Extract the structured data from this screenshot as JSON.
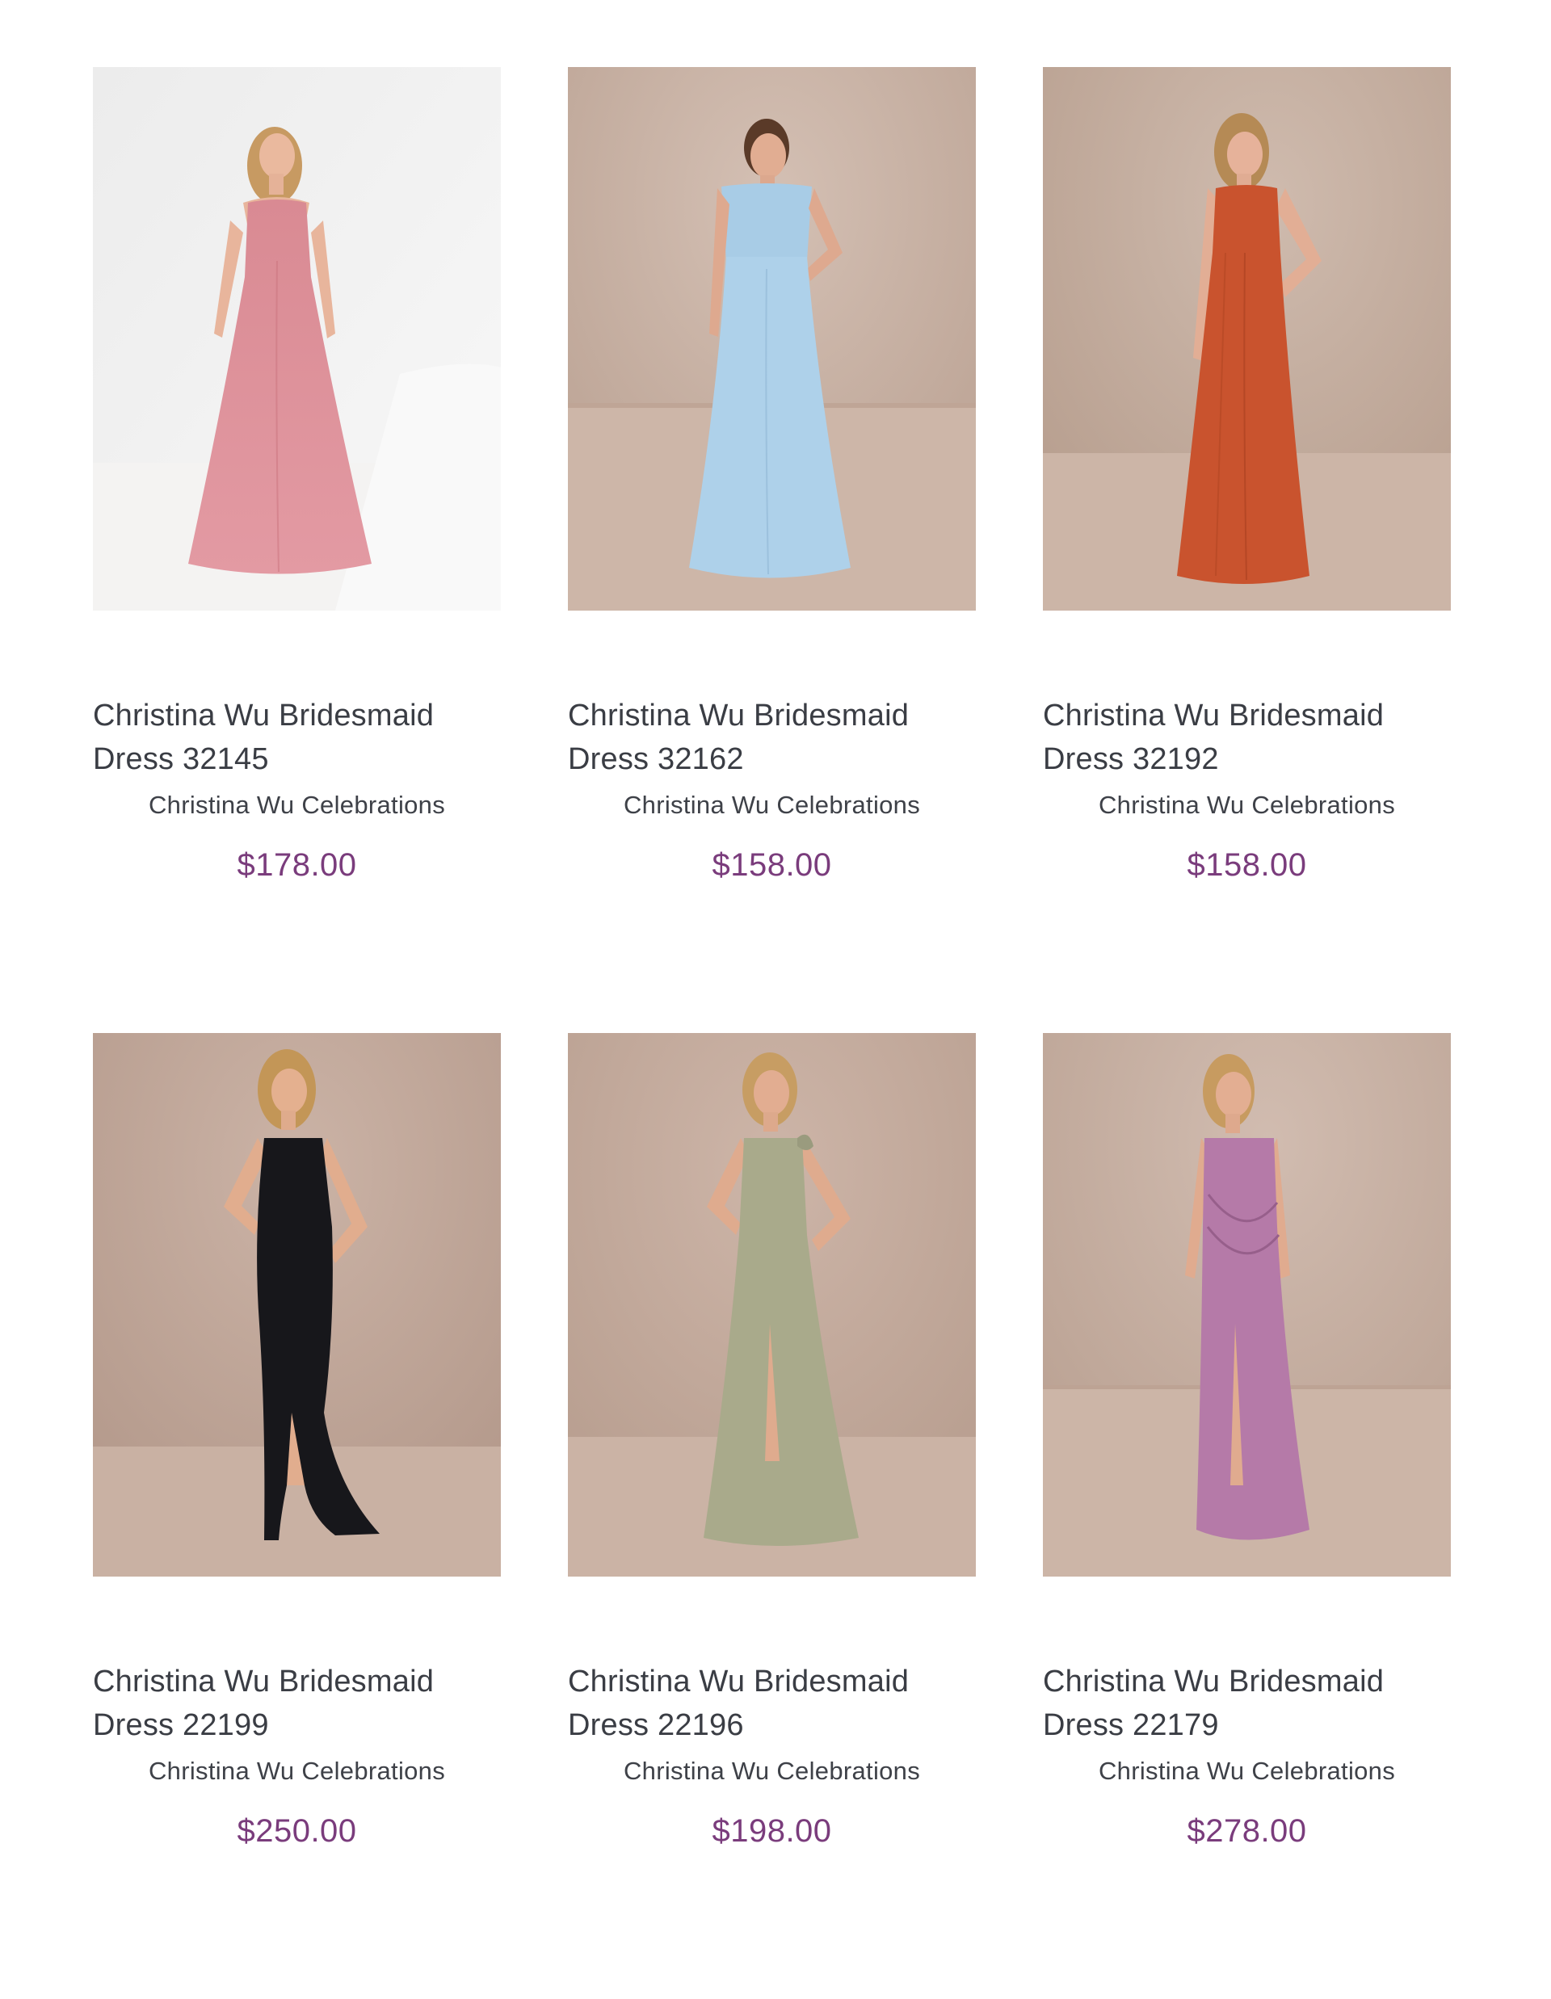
{
  "products": [
    {
      "title": "Christina Wu Bridesmaid Dress 32145",
      "brand": "Christina Wu Celebrations",
      "price": "$178.00",
      "dress_color": "#d9858f",
      "background": "light"
    },
    {
      "title": "Christina Wu Bridesmaid Dress 32162",
      "brand": "Christina Wu Celebrations",
      "price": "$158.00",
      "dress_color": "#a9cde8",
      "background": "taupe"
    },
    {
      "title": "Christina Wu Bridesmaid Dress 32192",
      "brand": "Christina Wu Celebrations",
      "price": "$158.00",
      "dress_color": "#c9532e",
      "background": "taupe"
    },
    {
      "title": "Christina Wu Bridesmaid Dress 22199",
      "brand": "Christina Wu Celebrations",
      "price": "$250.00",
      "dress_color": "#15151a",
      "background": "taupe"
    },
    {
      "title": "Christina Wu Bridesmaid Dress 22196",
      "brand": "Christina Wu Celebrations",
      "price": "$198.00",
      "dress_color": "#a8a98a",
      "background": "taupe"
    },
    {
      "title": "Christina Wu Bridesmaid Dress 22179",
      "brand": "Christina Wu Celebrations",
      "price": "$278.00",
      "dress_color": "#b57aa8",
      "background": "taupe"
    }
  ],
  "colors": {
    "title_text": "#3a3d44",
    "brand_text": "#3e4148",
    "price_text": "#7a3c7c",
    "taupe_wall": "#c3ab9e",
    "taupe_floor": "#d2bcae",
    "light_wall": "#efefef"
  }
}
